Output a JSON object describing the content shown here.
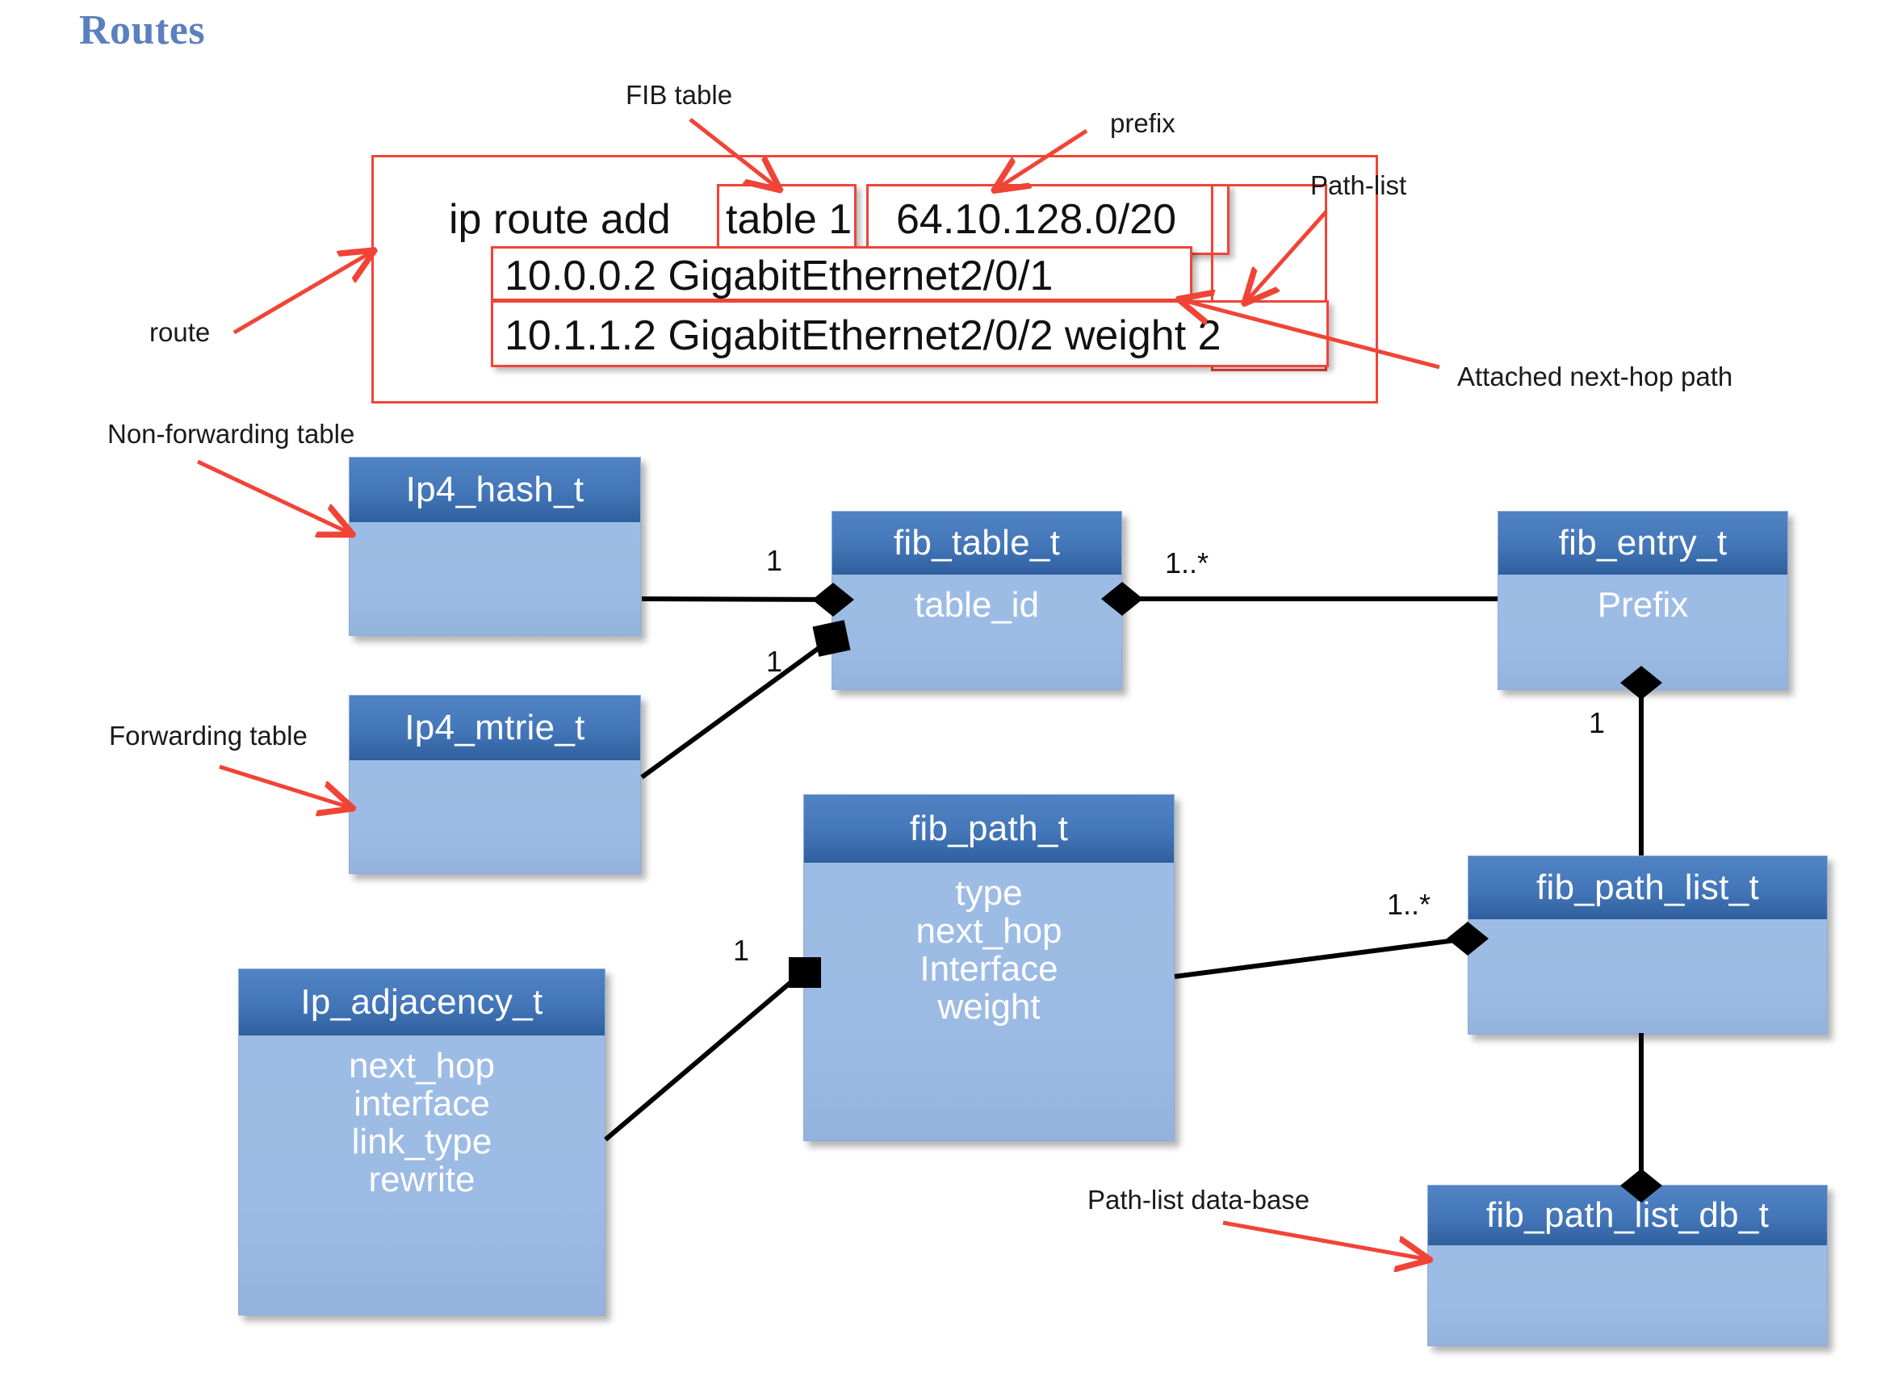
{
  "slide": {
    "title": "Routes"
  },
  "command": {
    "verb": "ip route add",
    "table": "table 1",
    "prefix": "64.10.128.0/20",
    "path_1": "10.0.0.2 GigabitEthernet2/0/1",
    "path_2": "10.1.1.2 GigabitEthernet2/0/2 weight 2"
  },
  "annotations": {
    "fib_table": "FIB table",
    "prefix": "prefix",
    "path_list": "Path-list",
    "route": "route",
    "attached_next_hop_path": "Attached next-hop path",
    "non_forwarding_table": "Non-forwarding table",
    "forwarding_table": "Forwarding table",
    "path_list_database": "Path-list data-base"
  },
  "classes": [
    {
      "id": "ip4_hash",
      "name": "Ip4_hash_t",
      "attributes": []
    },
    {
      "id": "ip4_mtrie",
      "name": "Ip4_mtrie_t",
      "attributes": []
    },
    {
      "id": "fib_table",
      "name": "fib_table_t",
      "attributes": [
        "table_id"
      ]
    },
    {
      "id": "fib_entry",
      "name": "fib_entry_t",
      "attributes": [
        "Prefix"
      ]
    },
    {
      "id": "fib_path",
      "name": "fib_path_t",
      "attributes": [
        "type",
        "next_hop",
        "Interface",
        "weight"
      ]
    },
    {
      "id": "fib_path_list",
      "name": "fib_path_list_t",
      "attributes": []
    },
    {
      "id": "fib_path_list_db",
      "name": "fib_path_list_db_t",
      "attributes": []
    },
    {
      "id": "ip_adjacency",
      "name": "Ip_adjacency_t",
      "attributes": [
        "next_hop",
        "interface",
        "link_type",
        "rewrite"
      ]
    }
  ],
  "multiplicities": {
    "hash_to_table": "1",
    "mtrie_to_table": "1",
    "table_to_entry": "1..*",
    "entry_to_pathlist": "1",
    "path_to_pathlist": "1..*",
    "adjacency_to_path": "1"
  },
  "colors": {
    "title": "#5b80bf",
    "annotation_red": "#f04437",
    "class_header": "#3d6fb2",
    "class_body": "#9cbbe4",
    "class_text": "#ffffff",
    "association_line": "#000000",
    "background": "#ffffff"
  }
}
